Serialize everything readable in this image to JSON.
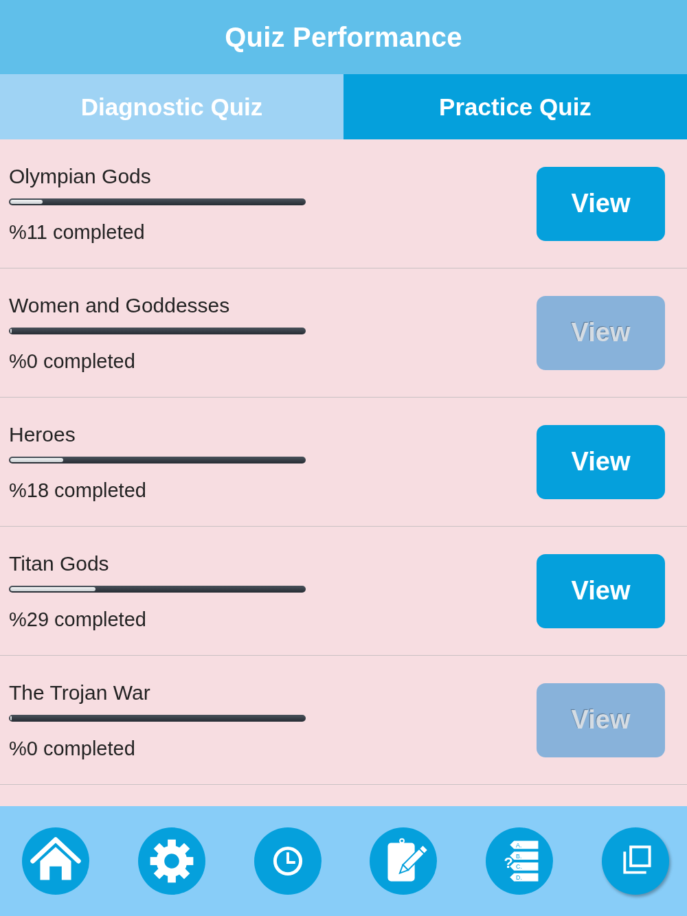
{
  "header": {
    "title": "Quiz Performance"
  },
  "tabs": [
    {
      "label": "Diagnostic Quiz",
      "selected": false
    },
    {
      "label": "Practice Quiz",
      "selected": true
    }
  ],
  "rows": [
    {
      "title": "Olympian Gods",
      "level": 0.11,
      "reading": "%11 completed",
      "button": {
        "label": "View",
        "disabled": false
      }
    },
    {
      "title": "Women and Goddesses",
      "level": 0,
      "reading": "%0 completed",
      "button": {
        "label": "View",
        "disabled": true
      }
    },
    {
      "title": "Heroes",
      "level": 0.18,
      "reading": "%18 completed",
      "button": {
        "label": "View",
        "disabled": false
      }
    },
    {
      "title": "Titan Gods",
      "level": 0.29,
      "reading": "%29 completed",
      "button": {
        "label": "View",
        "disabled": false
      }
    },
    {
      "title": "The Trojan War",
      "level": 0,
      "reading": "%0 completed",
      "button": {
        "label": "View",
        "disabled": true
      }
    }
  ],
  "nav_bar": [
    {
      "kind": "home"
    },
    {
      "kind": "settings"
    },
    {
      "kind": "history"
    },
    {
      "kind": "notes"
    },
    {
      "kind": "quiz",
      "question_mark": "?",
      "choices": [
        "A.",
        "B.",
        "C.",
        "D."
      ]
    },
    {
      "kind": "copy"
    }
  ]
}
